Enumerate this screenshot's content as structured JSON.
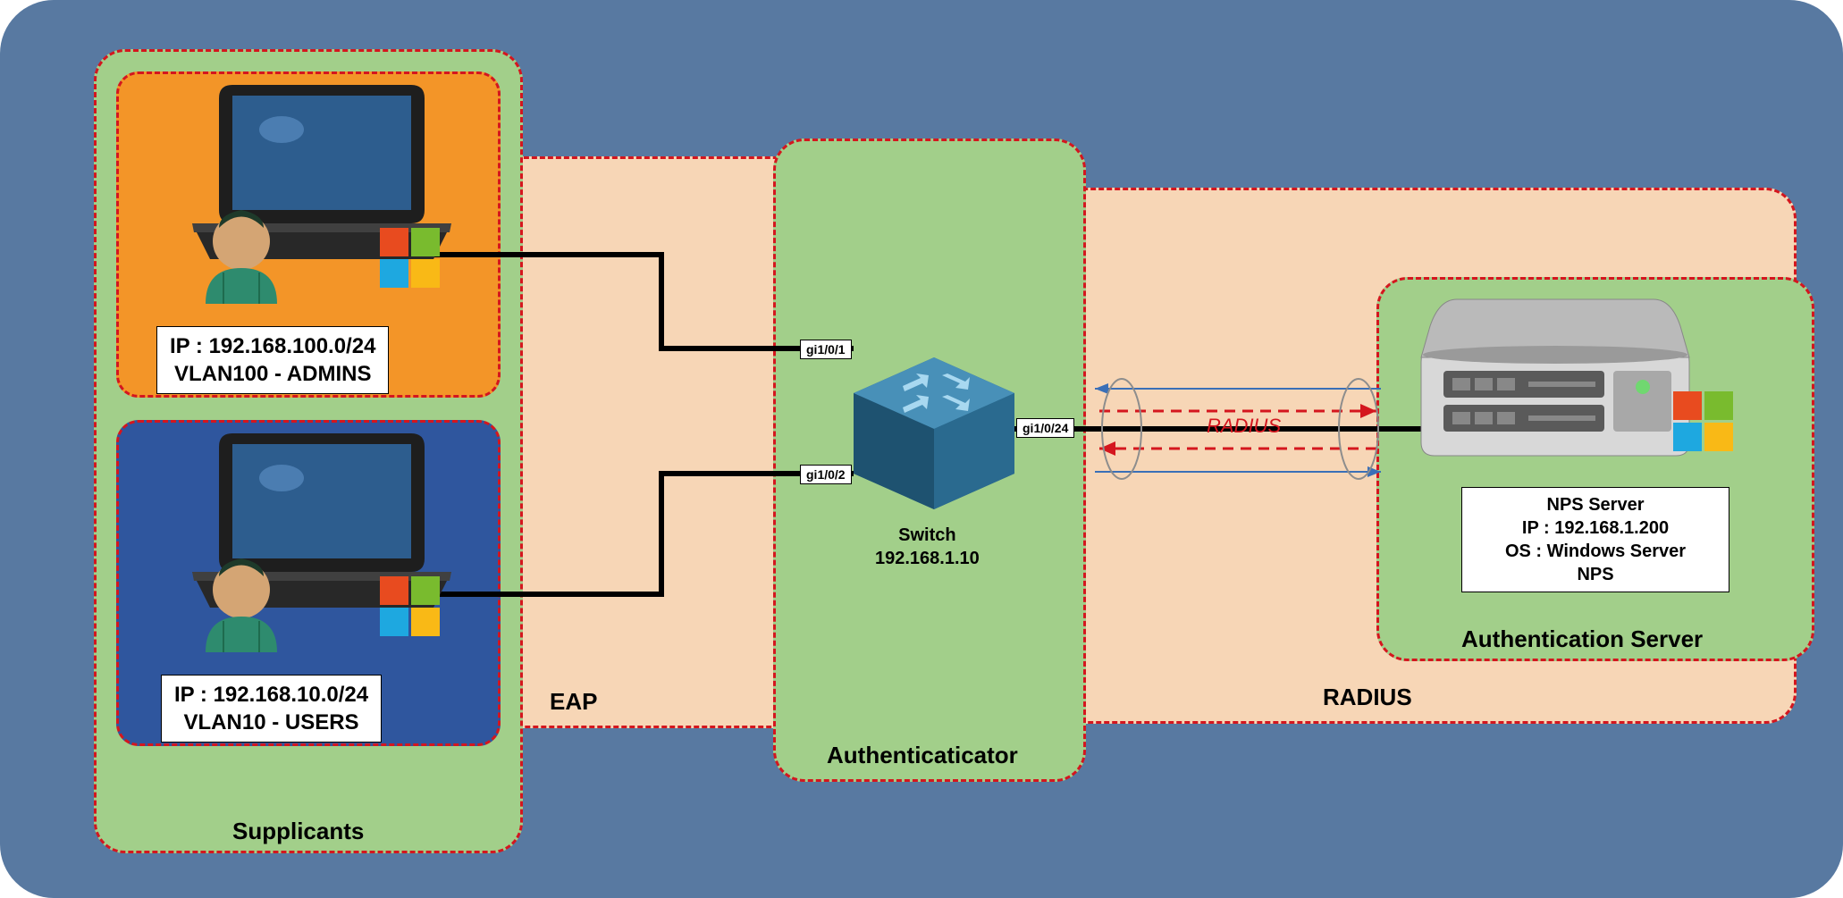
{
  "supplicants": {
    "title": "Supplicants",
    "client1": {
      "ip_line": "IP : 192.168.100.0/24",
      "vlan_line": "VLAN100 - ADMINS"
    },
    "client2": {
      "ip_line": "IP : 192.168.10.0/24",
      "vlan_line": "VLAN10 - USERS"
    }
  },
  "eap": {
    "title": "EAP"
  },
  "authenticator": {
    "title": "Authenticaticator",
    "switch_name": "Switch",
    "switch_ip": "192.168.1.10",
    "port1": "gi1/0/1",
    "port2": "gi1/0/2",
    "port24": "gi1/0/24"
  },
  "radius": {
    "title": "RADIUS",
    "link_text": "RADIUS"
  },
  "auth_server": {
    "title": "Authentication Server",
    "line1": "NPS Server",
    "line2": "IP : 192.168.1.200",
    "line3": "OS : Windows Server",
    "line4": "NPS"
  },
  "chart_data": {
    "type": "diagram",
    "nodes": [
      {
        "id": "client-admins",
        "role": "Supplicant",
        "subnet": "192.168.100.0/24",
        "vlan": "VLAN100",
        "group": "ADMINS"
      },
      {
        "id": "client-users",
        "role": "Supplicant",
        "subnet": "192.168.10.0/24",
        "vlan": "VLAN10",
        "group": "USERS"
      },
      {
        "id": "switch",
        "role": "Authenticator",
        "name": "Switch",
        "ip": "192.168.1.10",
        "ports": [
          "gi1/0/1",
          "gi1/0/2",
          "gi1/0/24"
        ]
      },
      {
        "id": "nps",
        "role": "Authentication Server",
        "name": "NPS Server",
        "ip": "192.168.1.200",
        "os": "Windows Server",
        "service": "NPS"
      }
    ],
    "edges": [
      {
        "from": "client-admins",
        "to": "switch",
        "port": "gi1/0/1",
        "protocol": "EAP"
      },
      {
        "from": "client-users",
        "to": "switch",
        "port": "gi1/0/2",
        "protocol": "EAP"
      },
      {
        "from": "switch",
        "to": "nps",
        "port": "gi1/0/24",
        "protocol": "RADIUS",
        "bidirectional": true
      }
    ],
    "zones": [
      "Supplicants",
      "EAP",
      "Authenticaticator",
      "RADIUS",
      "Authentication Server"
    ]
  }
}
